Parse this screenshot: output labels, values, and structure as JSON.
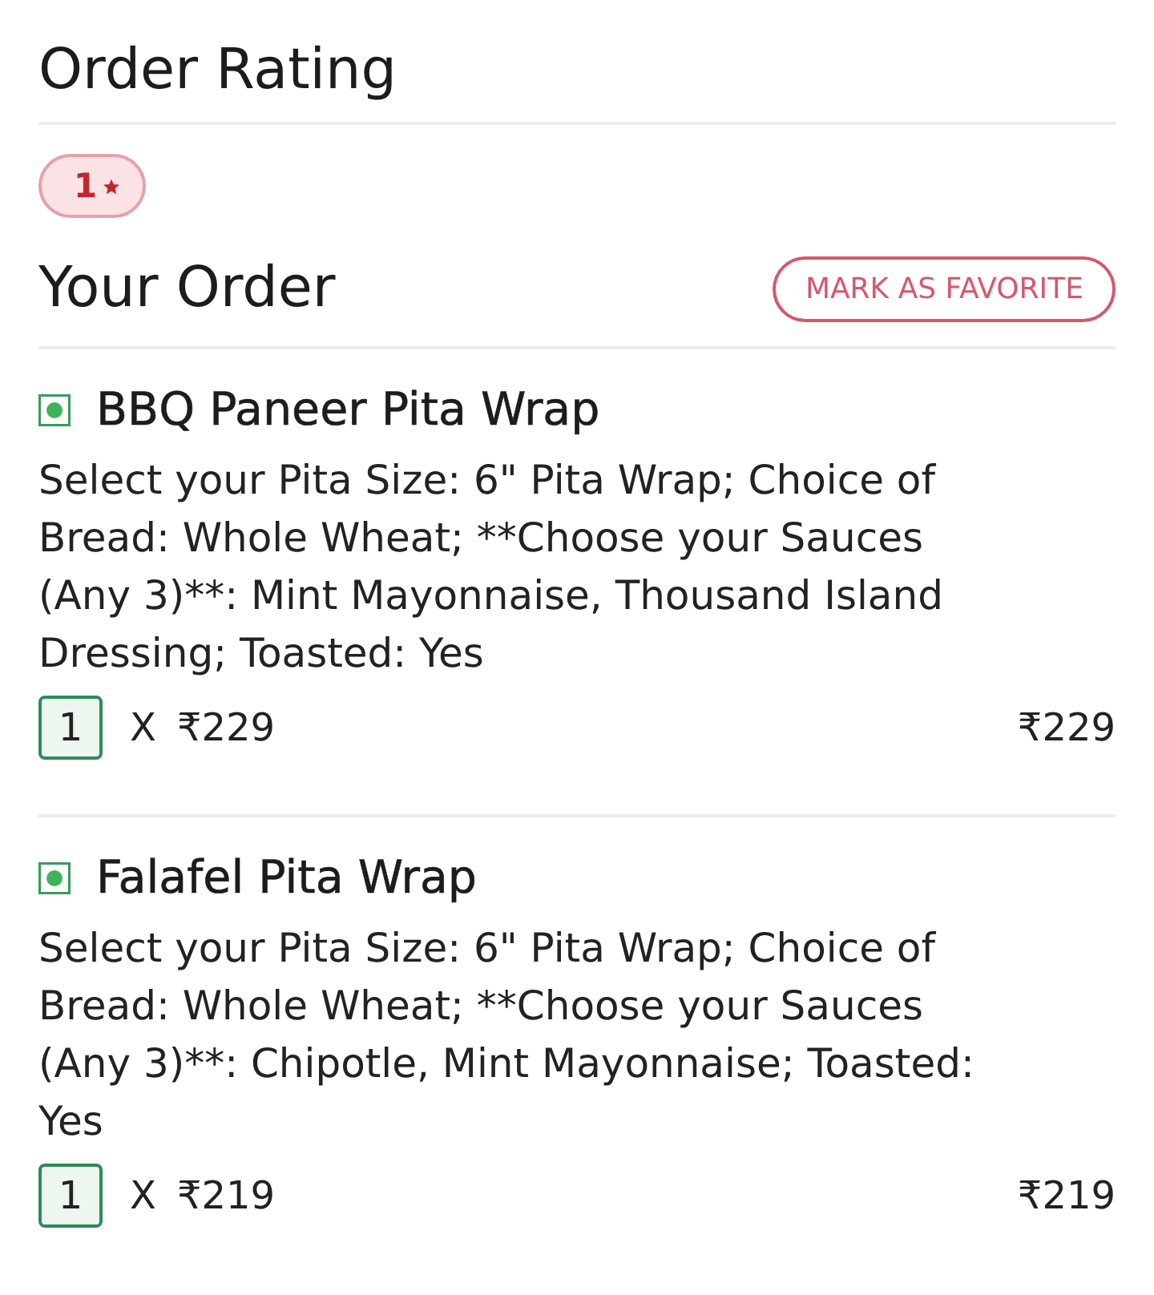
{
  "rating_section": {
    "title": "Order Rating",
    "rating": "1"
  },
  "order": {
    "title": "Your Order",
    "favorite_button": "MARK AS FAVORITE",
    "items": [
      {
        "name": "BBQ Paneer Pita Wrap",
        "veg": true,
        "description": "Select your Pita Size: 6\" Pita Wrap; Choice of Bread: Whole Wheat; **Choose your Sauces (Any 3)**: Mint Mayonnaise, Thousand Island Dressing; Toasted: Yes",
        "quantity": "1",
        "times": "X",
        "unit_price": "₹229",
        "total": "₹229"
      },
      {
        "name": "Falafel Pita Wrap",
        "veg": true,
        "description": "Select your Pita Size: 6\" Pita Wrap; Choice of Bread: Whole Wheat; **Choose your Sauces (Any 3)**: Chipotle, Mint Mayonnaise; Toasted: Yes",
        "quantity": "1",
        "times": "X",
        "unit_price": "₹219",
        "total": "₹219"
      }
    ]
  }
}
